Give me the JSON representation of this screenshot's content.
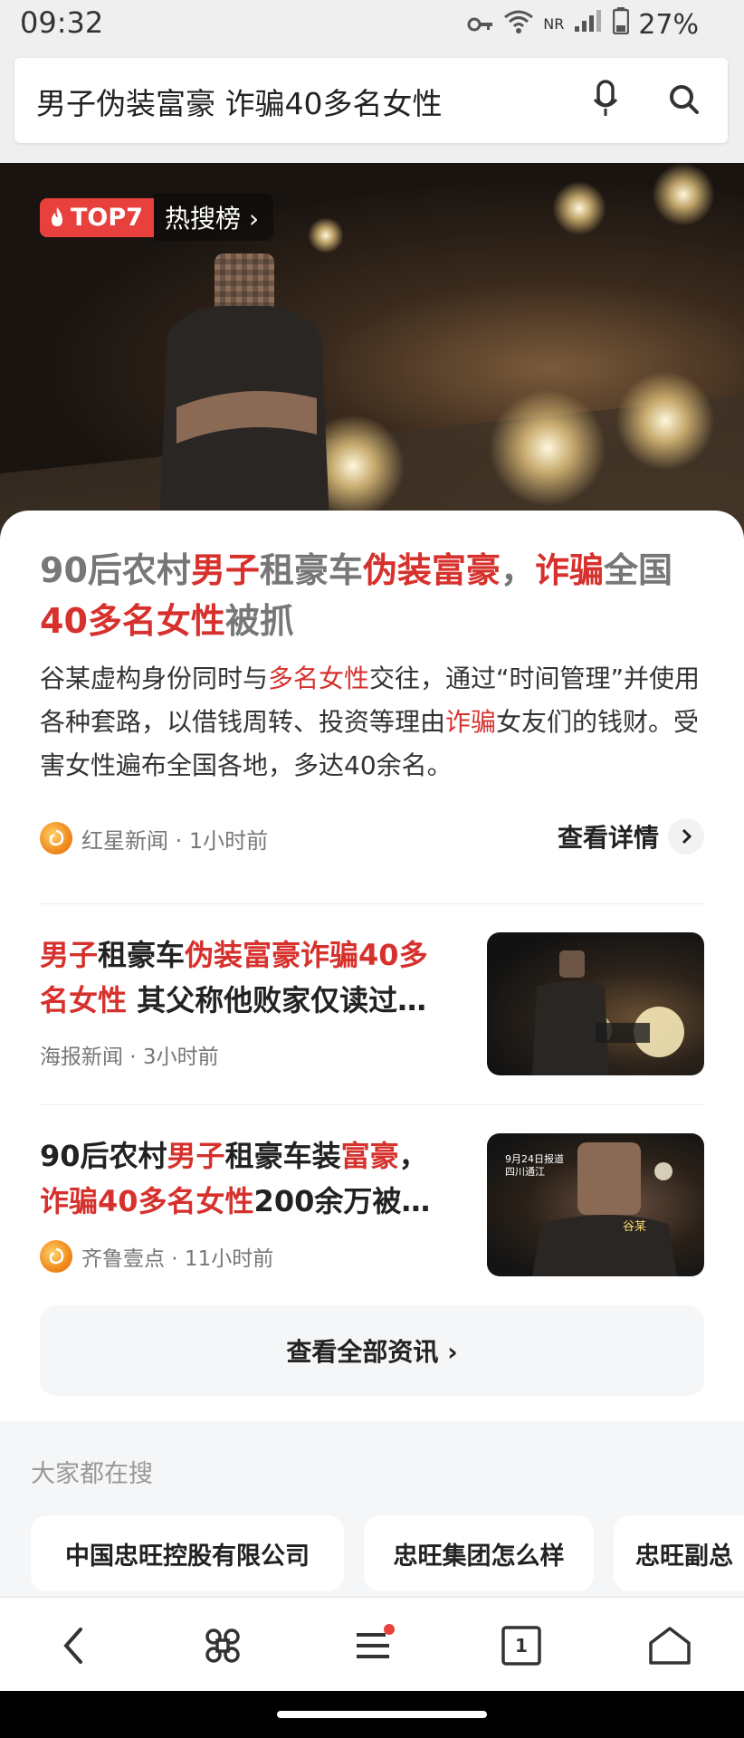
{
  "status": {
    "time": "09:32",
    "battery": "27%",
    "network": "NR"
  },
  "search": {
    "query": "男子伪装富豪 诈骗40多名女性"
  },
  "hero": {
    "badge": "TOP7",
    "hot_label": "热搜榜 ›"
  },
  "main": {
    "headline_parts": [
      {
        "t": "90后农村",
        "hl": false
      },
      {
        "t": "男子",
        "hl": true
      },
      {
        "t": "租豪车",
        "hl": false
      },
      {
        "t": "伪装富豪",
        "hl": true
      },
      {
        "t": "，",
        "hl": false
      },
      {
        "t": "诈骗",
        "hl": true
      },
      {
        "t": "全国",
        "hl": false
      },
      {
        "t": "40多名女性",
        "hl": true
      },
      {
        "t": "被抓",
        "hl": false
      }
    ],
    "summary_parts": [
      {
        "t": "谷某虚构身份同时与",
        "hl": false
      },
      {
        "t": "多名女性",
        "hl": true
      },
      {
        "t": "交往，通过“时间管理”并使用各种套路，以借钱周转、投资等理由",
        "hl": false
      },
      {
        "t": "诈骗",
        "hl": true
      },
      {
        "t": "女友们的钱财。受害女性遍布全国各地，多达40余名。",
        "hl": false
      }
    ],
    "source": "红星新闻 · 1小时前",
    "detail_label": "查看详情"
  },
  "news": [
    {
      "title_parts": [
        {
          "t": "男子",
          "hl": true
        },
        {
          "t": "租豪车",
          "hl": false
        },
        {
          "t": "伪装富豪诈骗40多名女性",
          "hl": true
        },
        {
          "t": " 其父称他败家仅读过…",
          "hl": false
        }
      ],
      "source": "海报新闻 · 3小时前",
      "thumb_text": "",
      "has_icon": false
    },
    {
      "title_parts": [
        {
          "t": "90后农村",
          "hl": false
        },
        {
          "t": "男子",
          "hl": true
        },
        {
          "t": "租豪车装",
          "hl": false
        },
        {
          "t": "富豪",
          "hl": true
        },
        {
          "t": "，",
          "hl": false
        },
        {
          "t": "诈骗40多名女性",
          "hl": true
        },
        {
          "t": "200余万被…",
          "hl": false
        }
      ],
      "source": "齐鲁壹点 · 11小时前",
      "thumb_text": "9月24日报道 四川通江",
      "thumb_caption": "谷某",
      "has_icon": true
    }
  ],
  "view_all_label": "查看全部资讯 ›",
  "related": {
    "heading": "大家都在搜",
    "chips": [
      "中国忠旺控股有限公司",
      "忠旺集团怎么样",
      "忠旺副总"
    ]
  },
  "colors": {
    "highlight": "#d6312d",
    "badge_red": "#e8403d"
  },
  "icons": [
    "back-icon",
    "apps-icon",
    "menu-icon",
    "tabs-icon",
    "home-icon",
    "mic-icon",
    "search-icon",
    "fire-icon"
  ],
  "bottom_nav": {
    "tab_count": "1"
  }
}
